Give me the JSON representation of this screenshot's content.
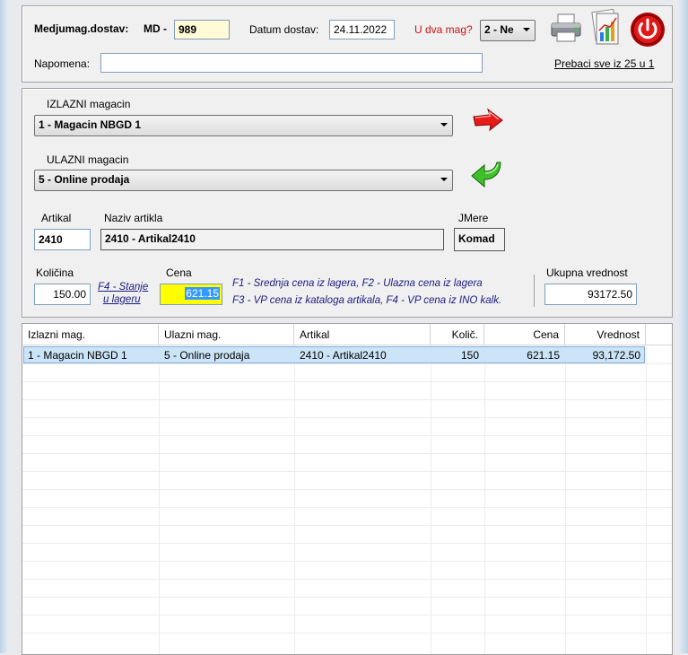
{
  "header": {
    "doc_label": "Medjumag.dostav:",
    "doc_prefix": "MD -",
    "doc_number": "989",
    "date_label": "Datum dostav:",
    "date_value": "24.11.2022",
    "two_wh_label": "U dva mag?",
    "two_wh_value": "2 - Ne",
    "note_label": "Napomena:",
    "note_value": "",
    "transfer_link": "Prebaci sve iz 25 u 1"
  },
  "warehouses": {
    "out_label": "IZLAZNI magacin",
    "out_value": "1 - Magacin NBGD 1",
    "in_label": "ULAZNI magacin",
    "in_value": "5 - Online prodaja"
  },
  "item": {
    "code_label": "Artikal",
    "code_value": "2410",
    "name_label": "Naziv artikla",
    "name_value": "2410 - Artikal2410",
    "uom_label": "JMere",
    "uom_value": "Komad",
    "qty_label": "Količina",
    "qty_value": "150.00",
    "stock_link_1": "F4 - Stanje",
    "stock_link_2": "u lageru",
    "price_label": "Cena",
    "price_value": "621.15",
    "hint_line1": "F1 - Srednja cena iz lagera, F2 - Ulazna cena iz lagera",
    "hint_line2": "F3 - VP cena iz kataloga artikala, F4 - VP cena iz INO kalk.",
    "total_label": "Ukupna vrednost",
    "total_value": "93172.50"
  },
  "table": {
    "columns": [
      "Izlazni mag.",
      "Ulazni mag.",
      "Artikal",
      "Količ.",
      "Cena",
      "Vrednost"
    ],
    "rows": [
      [
        "1 - Magacin NBGD 1",
        "5 - Online prodaja",
        "2410 - Artikal2410",
        "150",
        "621.15",
        "93,172.50"
      ]
    ]
  },
  "icons": {
    "print": "printer-icon",
    "report": "report-chart-icon",
    "power": "power-icon",
    "arrow_out": "red-arrow-icon",
    "arrow_in": "green-arrow-icon"
  },
  "colors": {
    "accent_red": "#d01010",
    "link_blue": "#1a1a80",
    "selected_row": "#cce4f7",
    "price_highlight": "#ffff00"
  }
}
